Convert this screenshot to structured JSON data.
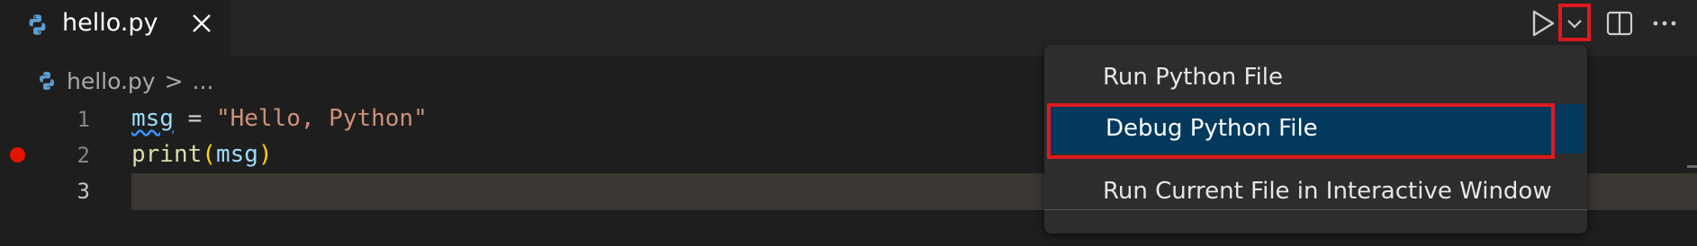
{
  "tab": {
    "title": "hello.py"
  },
  "breadcrumb": {
    "file": "hello.py",
    "separator": ">",
    "trail": "..."
  },
  "editor": {
    "line_numbers": [
      "1",
      "2",
      "3"
    ],
    "lines": [
      {
        "tokens": [
          "msg",
          " = ",
          "\"Hello, Python\""
        ]
      },
      {
        "tokens": [
          "print",
          "(",
          "msg",
          ")"
        ]
      },
      {
        "tokens": []
      }
    ],
    "breakpoint_line": 2
  },
  "toolbar": {
    "run_icon": "play-icon",
    "dropdown_icon": "chevron-down-icon",
    "split_icon": "split-editor-icon",
    "more_icon": "ellipsis-icon"
  },
  "menu": {
    "items": [
      {
        "label": "Run Python File"
      },
      {
        "label": "Debug Python File"
      },
      {
        "label": "Run Current File in Interactive Window"
      }
    ],
    "selected_index": 1
  },
  "colors": {
    "highlight_box": "#e0191f",
    "menu_selected": "#04395e",
    "breakpoint": "#e51400"
  }
}
